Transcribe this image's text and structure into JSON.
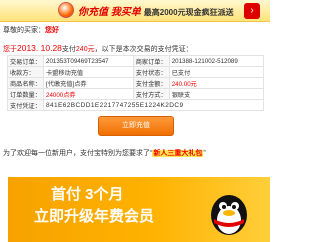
{
  "top_banner": {
    "headline": "你充值 我买单",
    "sub": "最高2000元现金疯狂派送"
  },
  "greeting": {
    "prefix": "尊敬的买家：",
    "name": "您好"
  },
  "notice": {
    "date_prefix": "您于",
    "date": "2013. 10.28",
    "middle": "支付",
    "amount": "240元",
    "suffix": "，以下是本次交易的支付凭证："
  },
  "order": {
    "rows": [
      {
        "label1": "交易订单：",
        "value1": "201353T09469T23547",
        "label2": "商家订单：",
        "value2": "201388-121002-512089"
      },
      {
        "label1": "收款方：",
        "value1": "卡盟移动充值",
        "label2": "支付状态：",
        "value2": "已支付"
      },
      {
        "label1": "商品名称：",
        "value1": "[代缴充值]点券",
        "label2": "支付金额：",
        "value2": "240.00元"
      },
      {
        "label1": "订单数量：",
        "value1": "24000点券",
        "label2": "支付方式：",
        "value2": "银联支"
      }
    ],
    "code_label": "支付凭证：",
    "code": "841E62BCDD1E2217747255E1224K2DC9"
  },
  "pay_button": {
    "label": "立即充值"
  },
  "promo": {
    "text_pre": "为了欢迎每一位新用户，支付宝特别为您要求了“",
    "tag": "新人三重大礼包",
    "text_post": "”"
  },
  "promo_banner": {
    "line1": "首付 3个月",
    "line2": "立即升级年费会员"
  },
  "colors": {
    "accent": "#e00000",
    "button": "#ef6f00",
    "banner": "#f7a200"
  }
}
